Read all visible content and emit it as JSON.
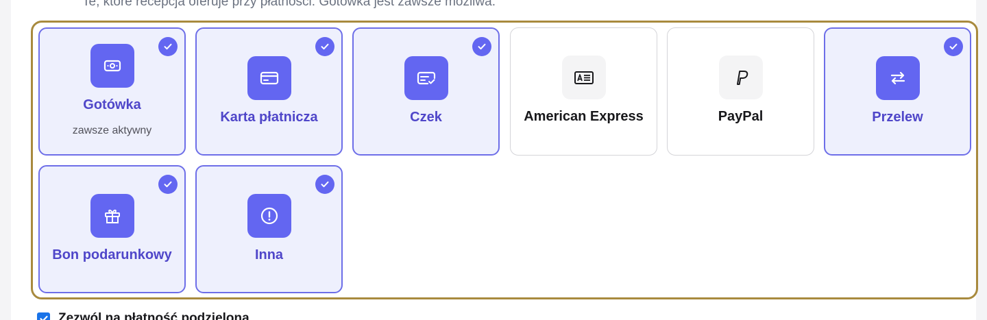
{
  "hint_text": "Te, które recepcja oferuje przy płatności. Gotówka jest zawsze możliwa.",
  "methods": [
    {
      "label": "Gotówka",
      "sublabel": "zawsze aktywny",
      "selected": true,
      "icon": "cash-icon"
    },
    {
      "label": "Karta płatnicza",
      "selected": true,
      "icon": "credit-card-icon"
    },
    {
      "label": "Czek",
      "selected": true,
      "icon": "check-payment-icon"
    },
    {
      "label": "American Express",
      "selected": false,
      "icon": "id-card-icon"
    },
    {
      "label": "PayPal",
      "selected": false,
      "icon": "paypal-icon"
    },
    {
      "label": "Przelew",
      "selected": true,
      "icon": "transfer-arrows-icon"
    },
    {
      "label": "Bon podarunkowy",
      "selected": true,
      "icon": "gift-icon"
    },
    {
      "label": "Inna",
      "selected": true,
      "icon": "alert-circle-icon"
    }
  ],
  "split_payment": {
    "label": "Zezwól na płatność podzieloną",
    "checked": true
  },
  "colors": {
    "accent": "#6366f1",
    "selected_bg": "#eef0fd",
    "highlight_border": "#a88a3e"
  }
}
